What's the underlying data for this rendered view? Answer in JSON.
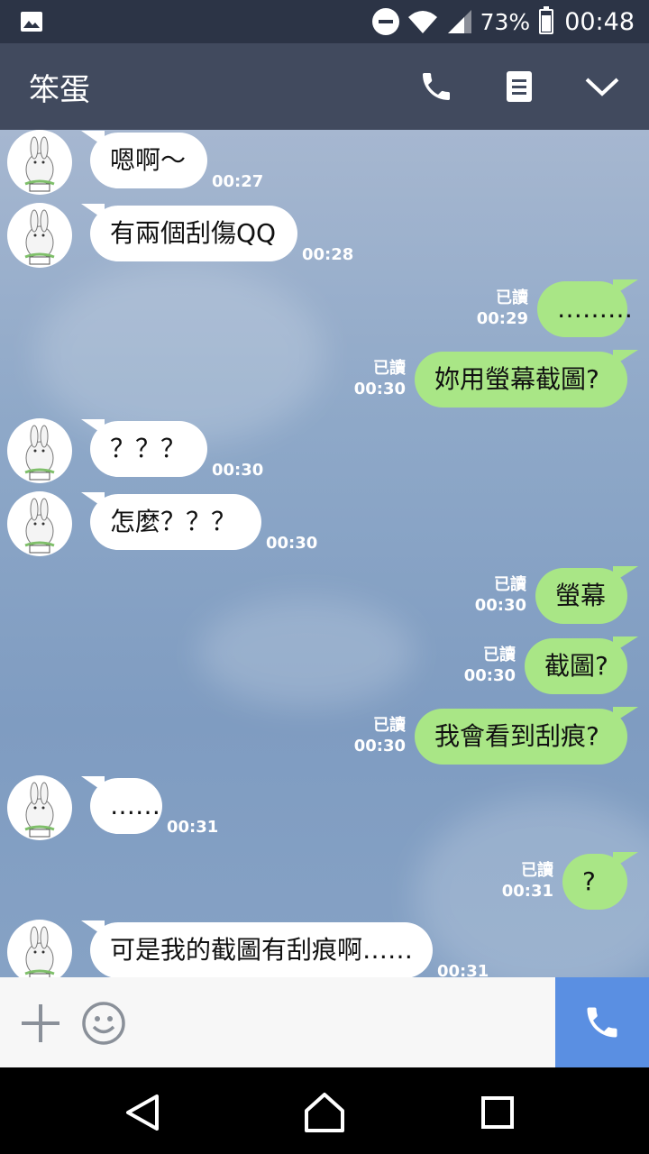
{
  "status_bar": {
    "battery_percent": "73%",
    "time": "00:48",
    "icons": [
      "gallery-icon",
      "do-not-disturb-icon",
      "wifi-icon",
      "signal-icon",
      "battery-icon"
    ]
  },
  "header": {
    "contact_name": "笨蛋",
    "icons": [
      "phone-icon",
      "notes-icon",
      "chevron-down-icon"
    ]
  },
  "messages": [
    {
      "direction": "in",
      "text": "嗯啊～",
      "time": "00:27"
    },
    {
      "direction": "in",
      "text": "有兩個刮傷QQ",
      "time": "00:28"
    },
    {
      "direction": "out",
      "text": "………",
      "read": "已讀",
      "time": "00:29"
    },
    {
      "direction": "out",
      "text": "妳用螢幕截圖?",
      "read": "已讀",
      "time": "00:30"
    },
    {
      "direction": "in",
      "text": "？？？",
      "time": "00:30"
    },
    {
      "direction": "in",
      "text": "怎麼？？？",
      "time": "00:30"
    },
    {
      "direction": "out",
      "text": "螢幕",
      "read": "已讀",
      "time": "00:30"
    },
    {
      "direction": "out",
      "text": "截圖?",
      "read": "已讀",
      "time": "00:30"
    },
    {
      "direction": "out",
      "text": "我會看到刮痕?",
      "read": "已讀",
      "time": "00:30"
    },
    {
      "direction": "in",
      "text": "……",
      "time": "00:31"
    },
    {
      "direction": "out",
      "text": "?",
      "read": "已讀",
      "time": "00:31"
    },
    {
      "direction": "in",
      "text": "可是我的截圖有刮痕啊……",
      "time": "00:31"
    }
  ],
  "input_bar": {
    "icons": [
      "plus-icon",
      "emoji-icon",
      "voice-call-icon"
    ]
  },
  "nav_bar": {
    "icons": [
      "back-icon",
      "home-icon",
      "recent-apps-icon"
    ]
  },
  "colors": {
    "status_bar": "#2c3446",
    "header": "#414a5e",
    "outgoing_bubble": "#a9e686",
    "incoming_bubble": "#ffffff",
    "call_button": "#5a8fe2"
  }
}
